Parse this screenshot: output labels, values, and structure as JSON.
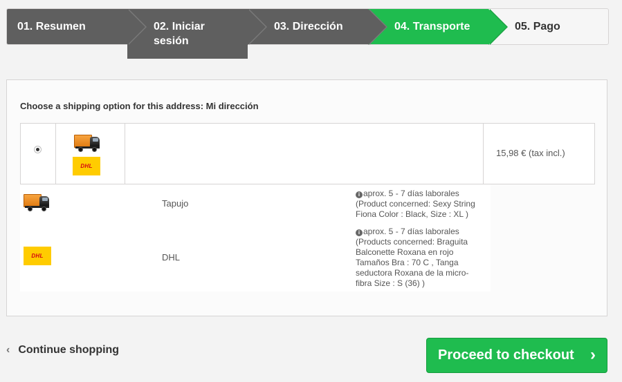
{
  "steps": [
    {
      "label": "01. Resumen",
      "state": "done"
    },
    {
      "label": "02. Iniciar sesión",
      "state": "done"
    },
    {
      "label": "03. Dirección",
      "state": "done"
    },
    {
      "label": "04. Transporte",
      "state": "active"
    },
    {
      "label": "05. Pago",
      "state": "todo"
    }
  ],
  "shipping": {
    "heading": "Choose a shipping option for this address: Mi dirección",
    "option": {
      "selected": true,
      "price": "15,98 € (tax incl.)",
      "icons": [
        "truck-icon",
        "dhl-logo"
      ]
    },
    "carriers": [
      {
        "name": "Tapujo",
        "icon": "truck-icon",
        "delay": "aprox. 5 - 7 días laborales",
        "products_line1": "(Product concerned: Sexy String",
        "products_line2": "Fiona Color : Black, Size : XL )"
      },
      {
        "name": "DHL",
        "icon": "dhl-logo",
        "logo_text": "DHL",
        "delay": "aprox. 5 - 7 días laborales",
        "products_line1": "(Products concerned: Braguita",
        "products_line2": "Balconette Roxana en rojo",
        "products_line3": "Tamaños Bra : 70 C ,  Tanga",
        "products_line4": "seductora Roxana de la micro-",
        "products_line5": "fibra Size : S (36) )"
      }
    ]
  },
  "actions": {
    "continue_label": "Continue shopping",
    "checkout_label": "Proceed to checkout"
  },
  "colors": {
    "accent_green": "#1fbc4f",
    "step_done": "#5f5f5f",
    "dhl_yellow": "#ffcc00",
    "dhl_red": "#d40511"
  }
}
